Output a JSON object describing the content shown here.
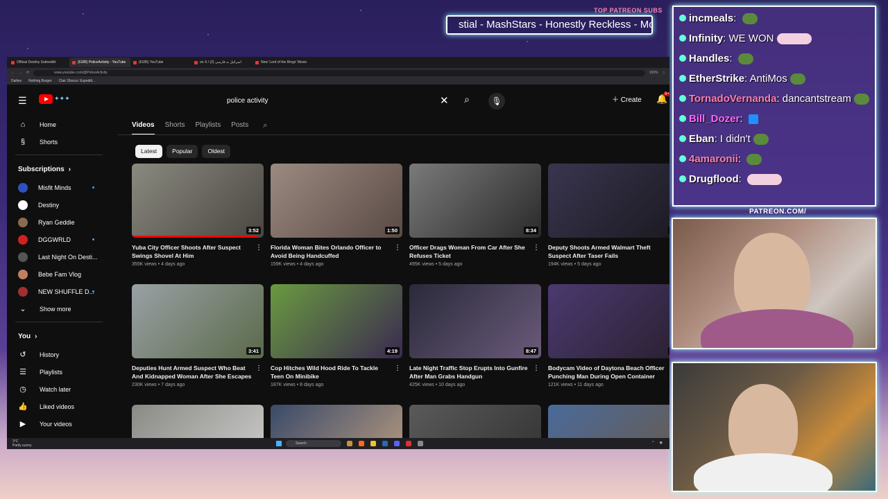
{
  "overlay": {
    "patreon_subs_label": "TOP PATREON SUBS",
    "ticker_text": "stial - MashStars - Honestly Reckless - Mo",
    "patreon_url": "PATREON.COM/",
    "chat": [
      {
        "user": "incmeals",
        "message": "",
        "user_color": "#ffffff",
        "emote": "green"
      },
      {
        "user": "Infinity",
        "message": "WE WON",
        "user_color": "#ffffff",
        "emote": "wide"
      },
      {
        "user": "Handles",
        "message": "",
        "user_color": "#ffffff",
        "emote": "green"
      },
      {
        "user": "EtherStrike",
        "message": "AntiMos",
        "user_color": "#ffffff",
        "emote": "face"
      },
      {
        "user": "TornadoVernanda",
        "message": "dancantstream",
        "user_color": "#ff7fb0",
        "emote": "face"
      },
      {
        "user": "Bill_Dozer",
        "message": "",
        "user_color": "#ff66ff",
        "emote": "square"
      },
      {
        "user": "Eban",
        "message": "I didn't",
        "user_color": "#ffffff",
        "emote": "ghost"
      },
      {
        "user": "4amaronii",
        "message": "",
        "user_color": "#ff7fb0",
        "emote": "green"
      },
      {
        "user": "Drugflood",
        "message": "",
        "user_color": "#ffffff",
        "emote": "wide"
      }
    ]
  },
  "browser": {
    "tabs": [
      {
        "label": "Official Destiny Subreddit"
      },
      {
        "label": "(6185) PoliceActivity - YouTube"
      },
      {
        "label": "(6185) YouTube"
      },
      {
        "label": "on X / اسرائیل به فارسی (2)"
      },
      {
        "label": "New 'Lord of the Rings' Movie"
      }
    ],
    "url": "www.youtube.com/@PoliceActivity",
    "zoom": "100%",
    "bookmarks": [
      "Dailies",
      "Nothing Burger",
      "Clair Obscur: Expediti..."
    ]
  },
  "youtube": {
    "search_query": "police activity",
    "create_label": "Create",
    "notif_count": "9+",
    "sidebar": {
      "home": "Home",
      "shorts": "Shorts",
      "subscriptions_title": "Subscriptions",
      "subscriptions": [
        {
          "name": "Misfit Minds",
          "color": "#3050c0",
          "dot": true
        },
        {
          "name": "Destiny",
          "color": "#ffffff",
          "dot": false
        },
        {
          "name": "Ryan Geddie",
          "color": "#8a6a50",
          "dot": false
        },
        {
          "name": "DGGWRLD",
          "color": "#d02020",
          "dot": true
        },
        {
          "name": "Last Night On Desti...",
          "color": "#555555",
          "dot": false
        },
        {
          "name": "Bebe Fam Vlog",
          "color": "#c08060",
          "dot": false
        },
        {
          "name": "NEW SHUFFLE D...",
          "color": "#a03030",
          "dot": true
        }
      ],
      "show_more": "Show more",
      "you_title": "You",
      "you_items": [
        "History",
        "Playlists",
        "Watch later",
        "Liked videos",
        "Your videos"
      ]
    },
    "channel_tabs": [
      "Videos",
      "Shorts",
      "Playlists",
      "Posts"
    ],
    "chips": [
      "Latest",
      "Popular",
      "Oldest"
    ],
    "videos": [
      {
        "title": "Yuba City Officer Shoots After Suspect Swings Shovel At Him",
        "views": "355K views",
        "age": "4 days ago",
        "duration": "3:52",
        "progress": 0.95,
        "color1": "#8a8a80",
        "color2": "#4a4540"
      },
      {
        "title": "Florida Woman Bites Orlando Officer to Avoid Being Handcuffed",
        "views": "159K views",
        "age": "4 days ago",
        "duration": "1:50",
        "progress": 0,
        "color1": "#9a8a80",
        "color2": "#5a4a45"
      },
      {
        "title": "Officer Drags Woman From Car After She Refuses Ticket",
        "views": "495K views",
        "age": "5 days ago",
        "duration": "8:34",
        "progress": 0,
        "color1": "#7a7a7a",
        "color2": "#2a2a2a"
      },
      {
        "title": "Deputy Shoots Armed Walmart Theft Suspect After Taser Fails",
        "views": "194K views",
        "age": "5 days ago",
        "duration": "4:",
        "progress": 0,
        "color1": "#3a3550",
        "color2": "#1a1a20"
      },
      {
        "title": "Deputies Hunt Armed Suspect Who Beat And Kidnapped Woman After She Escapes",
        "views": "230K views",
        "age": "7 days ago",
        "duration": "3:41",
        "progress": 0,
        "color1": "#9aa0a5",
        "color2": "#5a6a4a"
      },
      {
        "title": "Cop Hitches Wild Hood Ride To Tackle Teen On Minibike",
        "views": "187K views",
        "age": "8 days ago",
        "duration": "4:19",
        "progress": 0,
        "color1": "#6a9a40",
        "color2": "#3a2a50"
      },
      {
        "title": "Late Night Traffic Stop Erupts Into Gunfire After Man Grabs Handgun",
        "views": "425K views",
        "age": "10 days ago",
        "duration": "8:47",
        "progress": 0,
        "color1": "#2a2a3a",
        "color2": "#6a5a7a"
      },
      {
        "title": "Bodycam Video of Daytona Beach Officer Punching Man During Open Container Arrest",
        "views": "121K views",
        "age": "11 days ago",
        "duration": "5:",
        "progress": 0,
        "color1": "#4a3a70",
        "color2": "#2a2030"
      },
      {
        "title": "",
        "views": "",
        "age": "",
        "duration": "",
        "progress": 0,
        "color1": "#8a8a85",
        "color2": "#d0d0d0"
      },
      {
        "title": "",
        "views": "",
        "age": "",
        "duration": "",
        "progress": 0,
        "color1": "#3a4a6a",
        "color2": "#c0a080"
      },
      {
        "title": "",
        "views": "",
        "age": "",
        "duration": "",
        "progress": 0,
        "color1": "#5a5a5a",
        "color2": "#303030"
      },
      {
        "title": "",
        "views": "",
        "age": "",
        "duration": "",
        "progress": 0,
        "color1": "#4a6a9a",
        "color2": "#6a5a4a"
      }
    ]
  },
  "taskbar": {
    "weather_temp": "3°C",
    "weather_desc": "Partly sunny",
    "search_label": "Search"
  }
}
